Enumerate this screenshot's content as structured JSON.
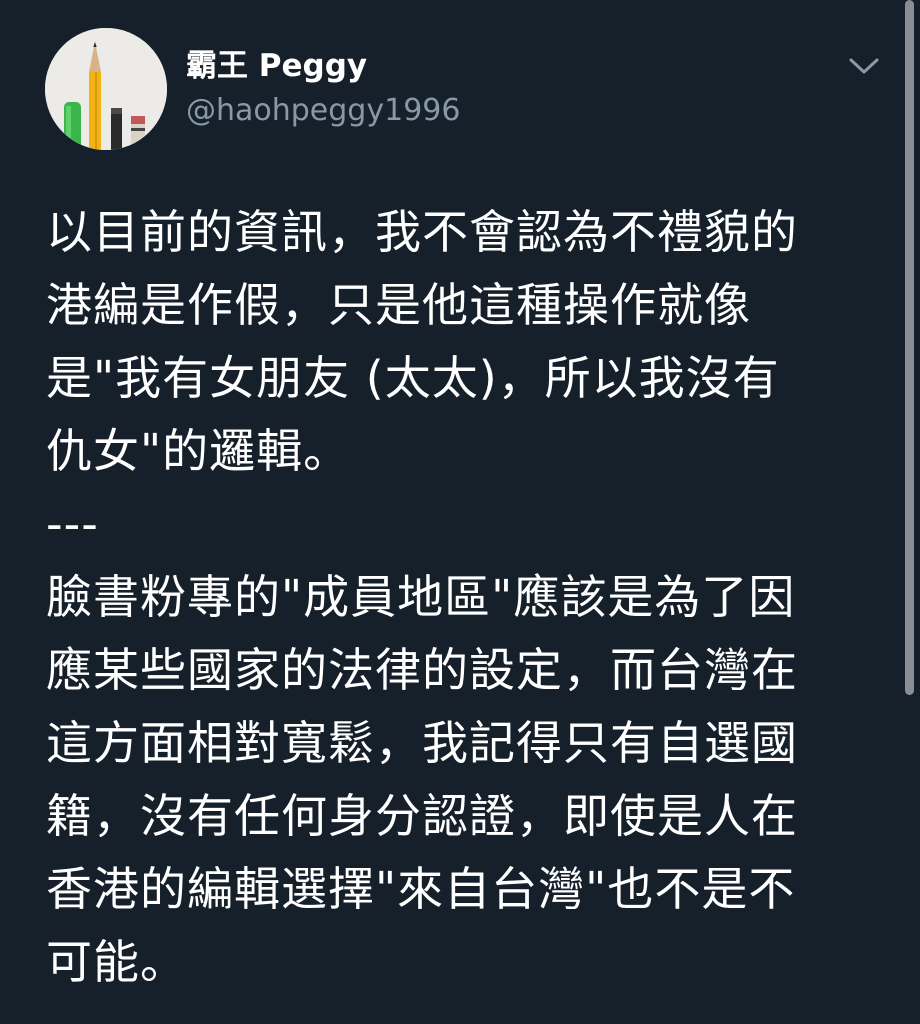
{
  "author": {
    "display_name": "霸王 Peggy",
    "handle": "@haohpeggy1996",
    "avatar": "avatar-pencils"
  },
  "menu_icon": "chevron-down-icon",
  "tweet": {
    "lines": [
      "以目前的資訊，我不會認為不禮貌的",
      "港編是作假，只是他這種操作就像",
      "是\"我有女朋友 (太太)，所以我沒有",
      "仇女\"的邏輯。",
      "---",
      "臉書粉專的\"成員地區\"應該是為了因",
      "應某些國家的法律的設定，而台灣在",
      "這方面相對寬鬆，我記得只有自選國",
      "籍，沒有任何身分認證，即使是人在",
      "香港的編輯選擇\"來自台灣\"也不是不",
      "可能。"
    ]
  },
  "colors": {
    "background": "#15202b",
    "text": "#ffffff",
    "secondary": "#8899a6"
  }
}
